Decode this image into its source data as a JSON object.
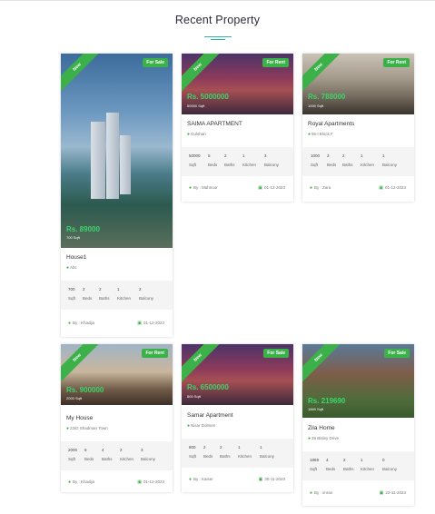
{
  "section": {
    "title": "Recent Property"
  },
  "cards": [
    {
      "ribbon": "New",
      "status": "For Sale",
      "price": "Rs. 89000",
      "area": "700 Sqft",
      "name": "House1",
      "location": "Abc",
      "specs": [
        {
          "num": "700",
          "label": "Sqft"
        },
        {
          "num": "2",
          "label": "Beds"
        },
        {
          "num": "2",
          "label": "Baths"
        },
        {
          "num": "1",
          "label": "Kitchen"
        },
        {
          "num": "2",
          "label": "Balcony"
        }
      ],
      "agent": "By : Khadija",
      "date": "01-12-2023"
    },
    {
      "ribbon": "New",
      "status": "For Rent",
      "price": "Rs. 5000000",
      "area": "50000 Sqft",
      "name": "SAIMA APARTMENT",
      "location": "Gulshan",
      "specs": [
        {
          "num": "50000",
          "label": "Sqft"
        },
        {
          "num": "5",
          "label": "Beds"
        },
        {
          "num": "2",
          "label": "Baths"
        },
        {
          "num": "1",
          "label": "Kitchen"
        },
        {
          "num": "3",
          "label": "Balcony"
        }
      ],
      "agent": "By : Mahnoor",
      "date": "01-12-2023"
    },
    {
      "ribbon": "New",
      "status": "For Rent",
      "price": "Rs. 788000",
      "area": "1000 Sqft",
      "name": "Royal Apartments",
      "location": "56-l Block F",
      "specs": [
        {
          "num": "1000",
          "label": "Sqft"
        },
        {
          "num": "3",
          "label": "Beds"
        },
        {
          "num": "2",
          "label": "Baths"
        },
        {
          "num": "1",
          "label": "Kitchen"
        },
        {
          "num": "1",
          "label": "Balcony"
        }
      ],
      "agent": "By : Zara",
      "date": "01-12-2023"
    },
    {
      "ribbon": "New",
      "status": "For Rent",
      "price": "Rs. 900000",
      "area": "2000 Sqft",
      "name": "My House",
      "location": "23/D Shadman Town",
      "specs": [
        {
          "num": "2000",
          "label": "Sqft"
        },
        {
          "num": "6",
          "label": "Beds"
        },
        {
          "num": "4",
          "label": "Baths"
        },
        {
          "num": "2",
          "label": "Kitchen"
        },
        {
          "num": "3",
          "label": "Balcony"
        }
      ],
      "agent": "By : Khadija",
      "date": "01-12-2023"
    },
    {
      "ribbon": "New",
      "status": "For Sale",
      "price": "Rs. 6500000",
      "area": "800 Sqft",
      "name": "Samar Apartment",
      "location": "Nisar Dolmen",
      "specs": [
        {
          "num": "800",
          "label": "Sqft"
        },
        {
          "num": "2",
          "label": "Beds"
        },
        {
          "num": "2",
          "label": "Baths"
        },
        {
          "num": "1",
          "label": "Kitchen"
        },
        {
          "num": "1",
          "label": "Balcony"
        }
      ],
      "agent": "By : Kaiser",
      "date": "30-11-2023"
    },
    {
      "ribbon": "New",
      "status": "For Sale",
      "price": "Rs. 219690",
      "area": "1869 Sqft",
      "name": "Zila Home",
      "location": "39 Bisley Drive",
      "specs": [
        {
          "num": "1869",
          "label": "Sqft"
        },
        {
          "num": "4",
          "label": "Beds"
        },
        {
          "num": "2",
          "label": "Baths"
        },
        {
          "num": "1",
          "label": "Kitchen"
        },
        {
          "num": "0",
          "label": "Balcony"
        }
      ],
      "agent": "By : imran",
      "date": "22-11-2023"
    }
  ]
}
